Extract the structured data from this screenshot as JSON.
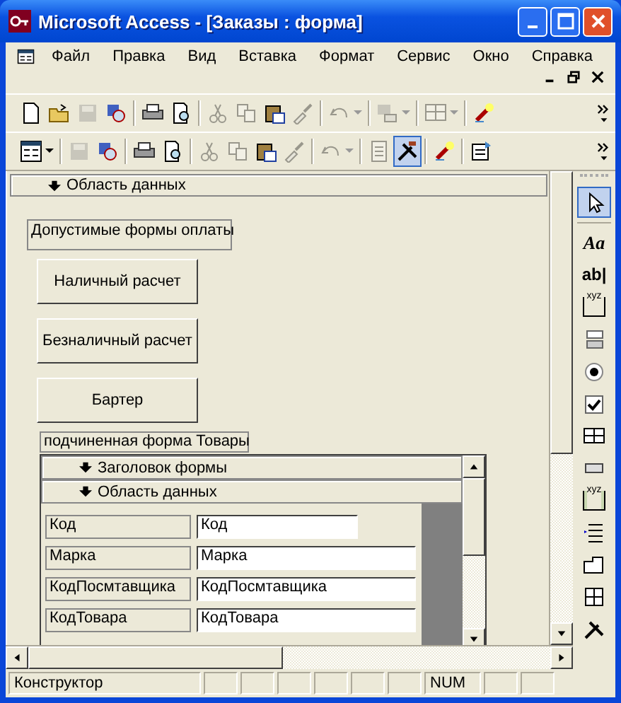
{
  "window": {
    "title": "Microsoft Access - [Заказы : форма]"
  },
  "menu": [
    "Файл",
    "Правка",
    "Вид",
    "Вставка",
    "Формат",
    "Сервис",
    "Окно",
    "Справка"
  ],
  "toolbars": [
    [
      {
        "kind": "new",
        "disabled": false,
        "dropdown": false,
        "pressed": false
      },
      {
        "kind": "open",
        "disabled": false,
        "dropdown": false,
        "pressed": false
      },
      {
        "kind": "save",
        "disabled": true,
        "dropdown": false,
        "pressed": false
      },
      {
        "kind": "search",
        "disabled": false,
        "dropdown": false,
        "pressed": false
      },
      {
        "kind": "sep"
      },
      {
        "kind": "print",
        "disabled": false,
        "dropdown": false,
        "pressed": false
      },
      {
        "kind": "preview",
        "disabled": false,
        "dropdown": false,
        "pressed": false
      },
      {
        "kind": "sep"
      },
      {
        "kind": "cut",
        "disabled": true,
        "dropdown": false,
        "pressed": false
      },
      {
        "kind": "copy",
        "disabled": true,
        "dropdown": false,
        "pressed": false
      },
      {
        "kind": "paste",
        "disabled": false,
        "dropdown": false,
        "pressed": false
      },
      {
        "kind": "brush",
        "disabled": true,
        "dropdown": false,
        "pressed": false
      },
      {
        "kind": "sep"
      },
      {
        "kind": "undo",
        "disabled": true,
        "dropdown": true,
        "pressed": false
      },
      {
        "kind": "sep"
      },
      {
        "kind": "office",
        "disabled": true,
        "dropdown": true,
        "pressed": false
      },
      {
        "kind": "sep"
      },
      {
        "kind": "grid",
        "disabled": true,
        "dropdown": true,
        "pressed": false
      },
      {
        "kind": "sep"
      },
      {
        "kind": "wand",
        "disabled": false,
        "dropdown": false,
        "pressed": false
      }
    ],
    [
      {
        "kind": "view",
        "disabled": false,
        "dropdown": true,
        "pressed": false
      },
      {
        "kind": "sep"
      },
      {
        "kind": "save",
        "disabled": true,
        "dropdown": false,
        "pressed": false
      },
      {
        "kind": "search",
        "disabled": false,
        "dropdown": false,
        "pressed": false
      },
      {
        "kind": "sep"
      },
      {
        "kind": "print",
        "disabled": false,
        "dropdown": false,
        "pressed": false
      },
      {
        "kind": "preview",
        "disabled": false,
        "dropdown": false,
        "pressed": false
      },
      {
        "kind": "sep"
      },
      {
        "kind": "cut",
        "disabled": true,
        "dropdown": false,
        "pressed": false
      },
      {
        "kind": "copy",
        "disabled": true,
        "dropdown": false,
        "pressed": false
      },
      {
        "kind": "paste",
        "disabled": false,
        "dropdown": false,
        "pressed": false
      },
      {
        "kind": "brush",
        "disabled": true,
        "dropdown": false,
        "pressed": false
      },
      {
        "kind": "sep"
      },
      {
        "kind": "undo",
        "disabled": true,
        "dropdown": true,
        "pressed": false
      },
      {
        "kind": "sep"
      },
      {
        "kind": "list",
        "disabled": true,
        "dropdown": false,
        "pressed": false
      },
      {
        "kind": "tools",
        "disabled": false,
        "dropdown": false,
        "pressed": true
      },
      {
        "kind": "sep"
      },
      {
        "kind": "wand",
        "disabled": false,
        "dropdown": false,
        "pressed": false
      },
      {
        "kind": "sep"
      },
      {
        "kind": "props",
        "disabled": false,
        "dropdown": false,
        "pressed": false
      }
    ]
  ],
  "form": {
    "section": "Область данных",
    "group_label": "Допустимые формы оплаты",
    "buttons": [
      "Наличный расчет",
      "Безналичный расчет",
      "Бартер"
    ],
    "subform": {
      "label": "подчиненная форма Товары",
      "header": "Заголовок формы",
      "section": "Область данных",
      "fields": [
        {
          "label": "Код",
          "value": "Код"
        },
        {
          "label": "Марка",
          "value": "Марка"
        },
        {
          "label": "КодПосмтавщика",
          "value": "КодПосмтавщика"
        },
        {
          "label": "КодТовара",
          "value": "КодТовара"
        }
      ]
    }
  },
  "toolbox": [
    {
      "kind": "pointer",
      "selected": true
    },
    {
      "kind": "label",
      "text": "Aa",
      "selected": false
    },
    {
      "kind": "textbox",
      "text": "ab|",
      "selected": false
    },
    {
      "kind": "group",
      "text": "xyz",
      "selected": false
    },
    {
      "kind": "toggle",
      "selected": false
    },
    {
      "kind": "radio",
      "selected": false
    },
    {
      "kind": "checkbox",
      "selected": false
    },
    {
      "kind": "combo",
      "selected": false
    },
    {
      "kind": "button",
      "selected": false
    },
    {
      "kind": "image",
      "text": "xyz",
      "selected": false
    },
    {
      "kind": "list",
      "selected": false
    },
    {
      "kind": "tab",
      "selected": false
    },
    {
      "kind": "subform",
      "selected": false
    },
    {
      "kind": "tools",
      "selected": false
    }
  ],
  "status_bar": {
    "mode": "Конструктор",
    "indicator": "NUM"
  }
}
